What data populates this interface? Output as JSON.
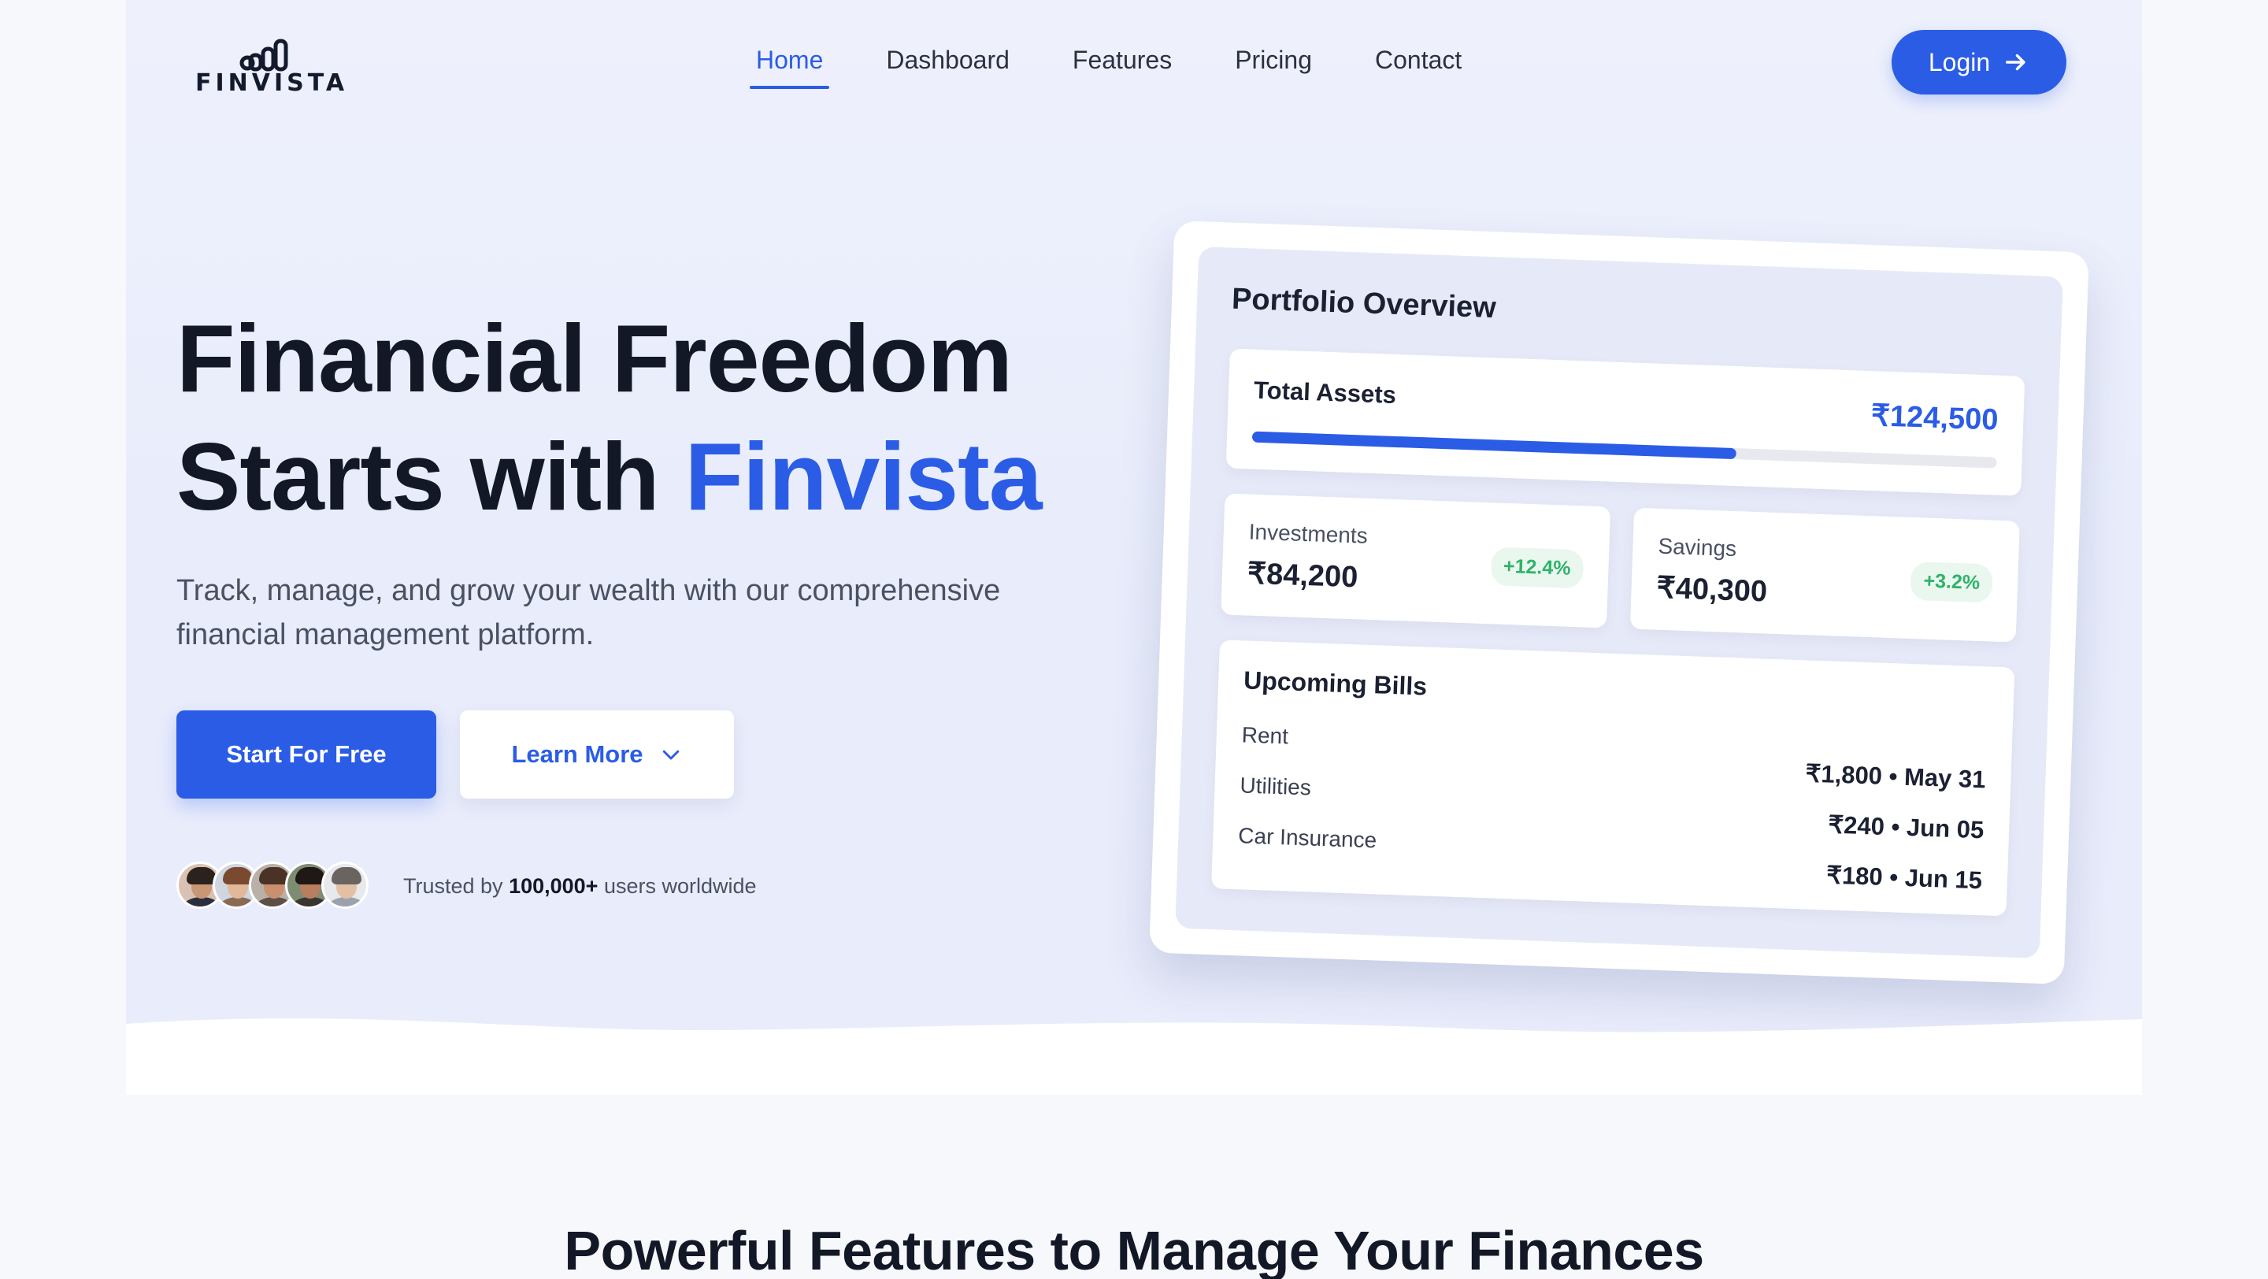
{
  "brand": {
    "name": "FINVISTA"
  },
  "nav": {
    "items": [
      {
        "label": "Home",
        "active": true
      },
      {
        "label": "Dashboard",
        "active": false
      },
      {
        "label": "Features",
        "active": false
      },
      {
        "label": "Pricing",
        "active": false
      },
      {
        "label": "Contact",
        "active": false
      }
    ],
    "login_label": "Login",
    "login_icon": "arrow-right-icon"
  },
  "hero": {
    "title_line1": "Financial Freedom",
    "title_line2_prefix": "Starts with ",
    "title_line2_accent": "Finvista",
    "subtitle": "Track, manage, and grow your wealth with our comprehensive financial management platform.",
    "cta_primary": "Start For Free",
    "cta_secondary": "Learn More",
    "cta_secondary_icon": "chevron-down-icon",
    "trusted_prefix": "Trusted by ",
    "trusted_count": "100,000+",
    "trusted_suffix": " users worldwide"
  },
  "portfolio": {
    "title": "Portfolio Overview",
    "total_assets_label": "Total Assets",
    "total_assets_value": "₹124,500",
    "total_assets_progress": 0.65,
    "investments": {
      "label": "Investments",
      "value": "₹84,200",
      "change": "+12.4%"
    },
    "savings": {
      "label": "Savings",
      "value": "₹40,300",
      "change": "+3.2%"
    },
    "bills_title": "Upcoming Bills",
    "bills": [
      {
        "name": "Rent",
        "amount": "₹1,800 • May 31"
      },
      {
        "name": "Utilities",
        "amount": "₹240 • Jun 05"
      },
      {
        "name": "Car Insurance",
        "amount": "₹180 • Jun 15"
      }
    ]
  },
  "features": {
    "title": "Powerful Features to Manage Your Finances"
  },
  "colors": {
    "accent": "#2b5ce6",
    "positive": "#2fb26a",
    "heading": "#131827"
  }
}
